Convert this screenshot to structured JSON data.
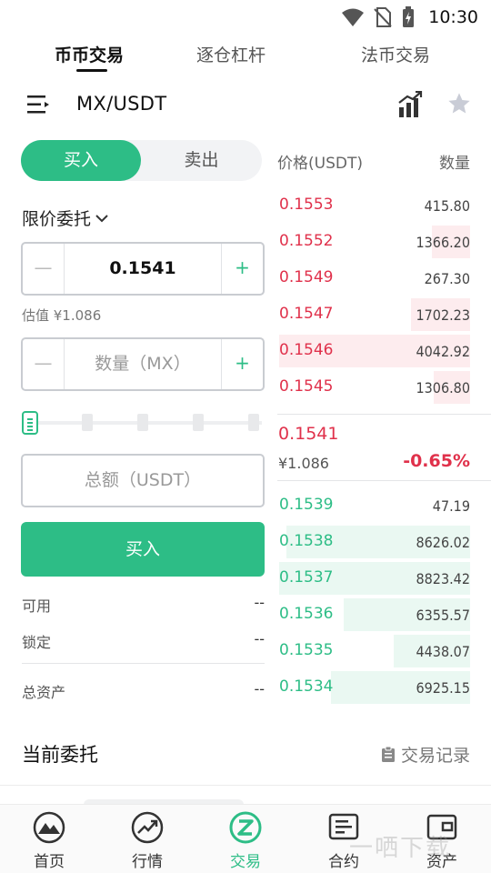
{
  "status_bar": {
    "time": "10:30"
  },
  "top_tabs": [
    {
      "label": "币币交易",
      "active": true
    },
    {
      "label": "逐仓杠杆",
      "active": false
    },
    {
      "label": "法币交易",
      "active": false
    }
  ],
  "pair": {
    "name": "MX/USDT"
  },
  "trade_side": {
    "buy": "买入",
    "sell": "卖出"
  },
  "order_type": {
    "label": "限价委托"
  },
  "price_input": {
    "value": "0.1541",
    "minus": "—",
    "plus": "+"
  },
  "estimate": "估值 ¥1.086",
  "amount_input": {
    "placeholder": "数量（MX）",
    "minus": "—",
    "plus": "+"
  },
  "total_input": {
    "placeholder": "总额（USDT）"
  },
  "buy_button": "买入",
  "balances": {
    "available_label": "可用",
    "available_value": "--",
    "locked_label": "锁定",
    "locked_value": "--",
    "total_label": "总资产",
    "total_value": "--"
  },
  "order_book": {
    "price_header": "价格(USDT)",
    "qty_header": "数量",
    "asks": [
      {
        "price": "0.1553",
        "qty": "415.80",
        "depth": 0.0
      },
      {
        "price": "0.1552",
        "qty": "1366.20",
        "depth": 0.2
      },
      {
        "price": "0.1549",
        "qty": "267.30",
        "depth": 0.0
      },
      {
        "price": "0.1547",
        "qty": "1702.23",
        "depth": 0.31
      },
      {
        "price": "0.1546",
        "qty": "4042.92",
        "depth": 1.0
      },
      {
        "price": "0.1545",
        "qty": "1306.80",
        "depth": 0.19
      }
    ],
    "last_price": "0.1541",
    "last_cny": "¥1.086",
    "change": "-0.65%",
    "bids": [
      {
        "price": "0.1539",
        "qty": "47.19",
        "depth": 0.0
      },
      {
        "price": "0.1538",
        "qty": "8626.02",
        "depth": 0.96
      },
      {
        "price": "0.1537",
        "qty": "8823.42",
        "depth": 1.0
      },
      {
        "price": "0.1536",
        "qty": "6355.57",
        "depth": 0.66
      },
      {
        "price": "0.1535",
        "qty": "4438.07",
        "depth": 0.4
      },
      {
        "price": "0.1534",
        "qty": "6925.15",
        "depth": 0.73
      }
    ]
  },
  "current_orders": {
    "title": "当前委托",
    "record_link": "交易记录"
  },
  "bottom_nav": [
    {
      "label": "首页",
      "icon": "home-mountain-icon",
      "active": false
    },
    {
      "label": "行情",
      "icon": "trend-chart-icon",
      "active": false
    },
    {
      "label": "交易",
      "icon": "trade-z-icon",
      "active": true
    },
    {
      "label": "合约",
      "icon": "contract-document-icon",
      "active": false
    },
    {
      "label": "资产",
      "icon": "wallet-icon",
      "active": false
    }
  ],
  "watermark": "一哂下载",
  "colors": {
    "green": "#2dbd86",
    "red": "#e0314b"
  }
}
